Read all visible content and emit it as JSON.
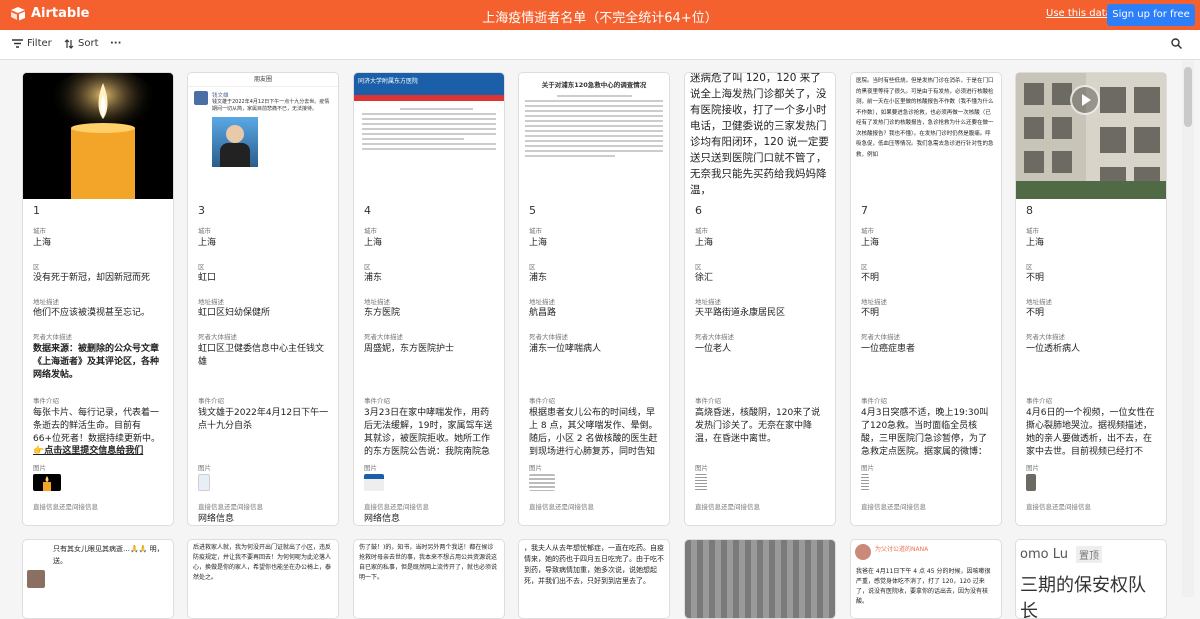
{
  "app": {
    "brand": "Airtable",
    "title": "上海疫情逝者名单（不完全统计64+位）",
    "use_data": "Use this data",
    "signup": "Sign up for free"
  },
  "toolbar": {
    "filter": "Filter",
    "sort": "Sort",
    "more": "···"
  },
  "labels": {
    "city": "城市",
    "district": "区",
    "address": "地址描述",
    "identity": "死者大体描述",
    "event": "事件介绍",
    "image": "图片",
    "source": "直接信息还是间接信息"
  },
  "cards": [
    {
      "num": "1",
      "city": "上海",
      "district": "没有死于新冠，却因新冠而死",
      "address": "他们不应该被漠视甚至忘记。",
      "identity": "数据来源：被删除的公众号文章《上海逝者》及其评论区，各种网络发帖。",
      "event": "每张卡片、每行记录，代表着一条逝去的鲜活生命。目前有66+位死者！数据持续更新中。",
      "event_link": "👉点击这里提交信息给我们",
      "source_val": ""
    },
    {
      "num": "3",
      "city": "上海",
      "district": "虹口",
      "address": "虹口区妇幼保健所",
      "identity": "虹口区卫健委信息中心主任钱文雄",
      "event": "钱文雄于2022年4月12日下午一点十九分自杀",
      "source_val": "网络信息",
      "img_title": "朋友圈",
      "img_name": "钱文雄",
      "img_text": "钱文雄于2022年4月12日下午一点十九分去世。疫情期间一切从简，家属目前悲痛不已，无法接待。"
    },
    {
      "num": "4",
      "city": "上海",
      "district": "浦东",
      "address": "东方医院",
      "identity": "周盛妮，东方医院护士",
      "event": "3月23日在家中哮喘发作，用药后无法缓解，19时，家属驾车送其就诊，被医院拒收。她所工作的东方医院公告说：我院南院急诊部因疫情…",
      "source_val": "网络信息",
      "img_header": "同济大学附属东方医院"
    },
    {
      "num": "5",
      "city": "上海",
      "district": "浦东",
      "address": "航昌路",
      "identity": "浦东一位哮喘病人",
      "event": "根据患者女儿公布的时间线，早上 8 点，其父哮喘发作、晕倒。随后，小区 2 名做核酸的医生赶到现场进行心肺复苏，同时告知其家人需要 …",
      "source_val": "",
      "img_title": "关于对浦东120急救中心的调查情况"
    },
    {
      "num": "6",
      "city": "上海",
      "district": "徐汇",
      "address": "天平路街道永康居民区",
      "identity": "一位老人",
      "event": "高烧昏迷，核酸阴，120来了说发热门诊关了。无奈在家中降温，在昏迷中离世。",
      "source_val": "",
      "img_text": "迷病危了叫 120，120 来了说全上海发热门诊都关了，没有医院接收，打了一个多小时电话，卫健委说的三家发热门诊均有阳闭环，120 说一定要送只送到医院门口就不管了，无奈我只能先买药给我妈妈降温，"
    },
    {
      "num": "7",
      "city": "上海",
      "district": "不明",
      "address": "不明",
      "identity": "一位癌症患者",
      "event": "4月3日突感不适，晚上19:30叫了120急救。当时面临全员核酸，三甲医院门急诊暂停，为了急救定点医院。据家属的微博：病人急需去急…",
      "source_val": "",
      "img_text": "医院。当时有些低烧，但是发热门诊在消杀，于是在门口的黑夜里等待了很久。可是由于有发热，必须进行核酸检测，前一天在小区里做的核酸报告不作数（我不懂为什么不作数），如果要进急诊抢救，也必须再做一次核酸（已经有了发热门诊的核酸报告，急诊抢救为什么还要在做一次核酸报告？我也不懂）。在发热门诊时仍然是腹痛。呼吸急促，低血压等情况。我们急需去急诊进行针对性的急救，例如"
    },
    {
      "num": "8",
      "city": "上海",
      "district": "不明",
      "address": "不明",
      "identity": "一位透析病人",
      "event": "4月6日的一个视频，一位女性在撕心裂肺地哭泣。据视频描述，她的亲人要做透析，出不去，在家中去世。目前视频已经打不开。",
      "source_val": ""
    }
  ],
  "row2": {
    "c1": "只有其女儿眼见其病逝…🙏🙏 明，送。",
    "c2": "后进救家人就，我为何没开出门证就出了小区，违反防疫规定，并让我不要再回去！为何何呢为此沦落人心，换做是你的家人，希望你也能坐在办公椅上，泰然处之。",
    "c3": "伤了鼓！)的，知书，当时另外两个我送！都在候诊抢救时母亲去世的事，我本来不想占用公共资源说这自已家的私事，但是既然网上流传开了，就也必须说明一下。",
    "c4": "，我夫人从去年想忧郁症，一直在吃药。自疫情来，她的药也于四月五日吃完了。由于吃不到药，导致病情加重，她多次说，说她想起死，并我们出不去，只好到到店里去了。",
    "c6_name": "为父讨公道的NANA",
    "c6_text": "我爸在 4月11日下午 4 点 45 分的时候，因咳嗽很严重，感觉身体吃不消了，打了 120，120 过来了，说没有医院收，要拿你的话出去，因为没有核酸。",
    "c7_name": "omo Lu",
    "c7_tag": "置顶",
    "c7_text": "三期的保安权队长"
  }
}
